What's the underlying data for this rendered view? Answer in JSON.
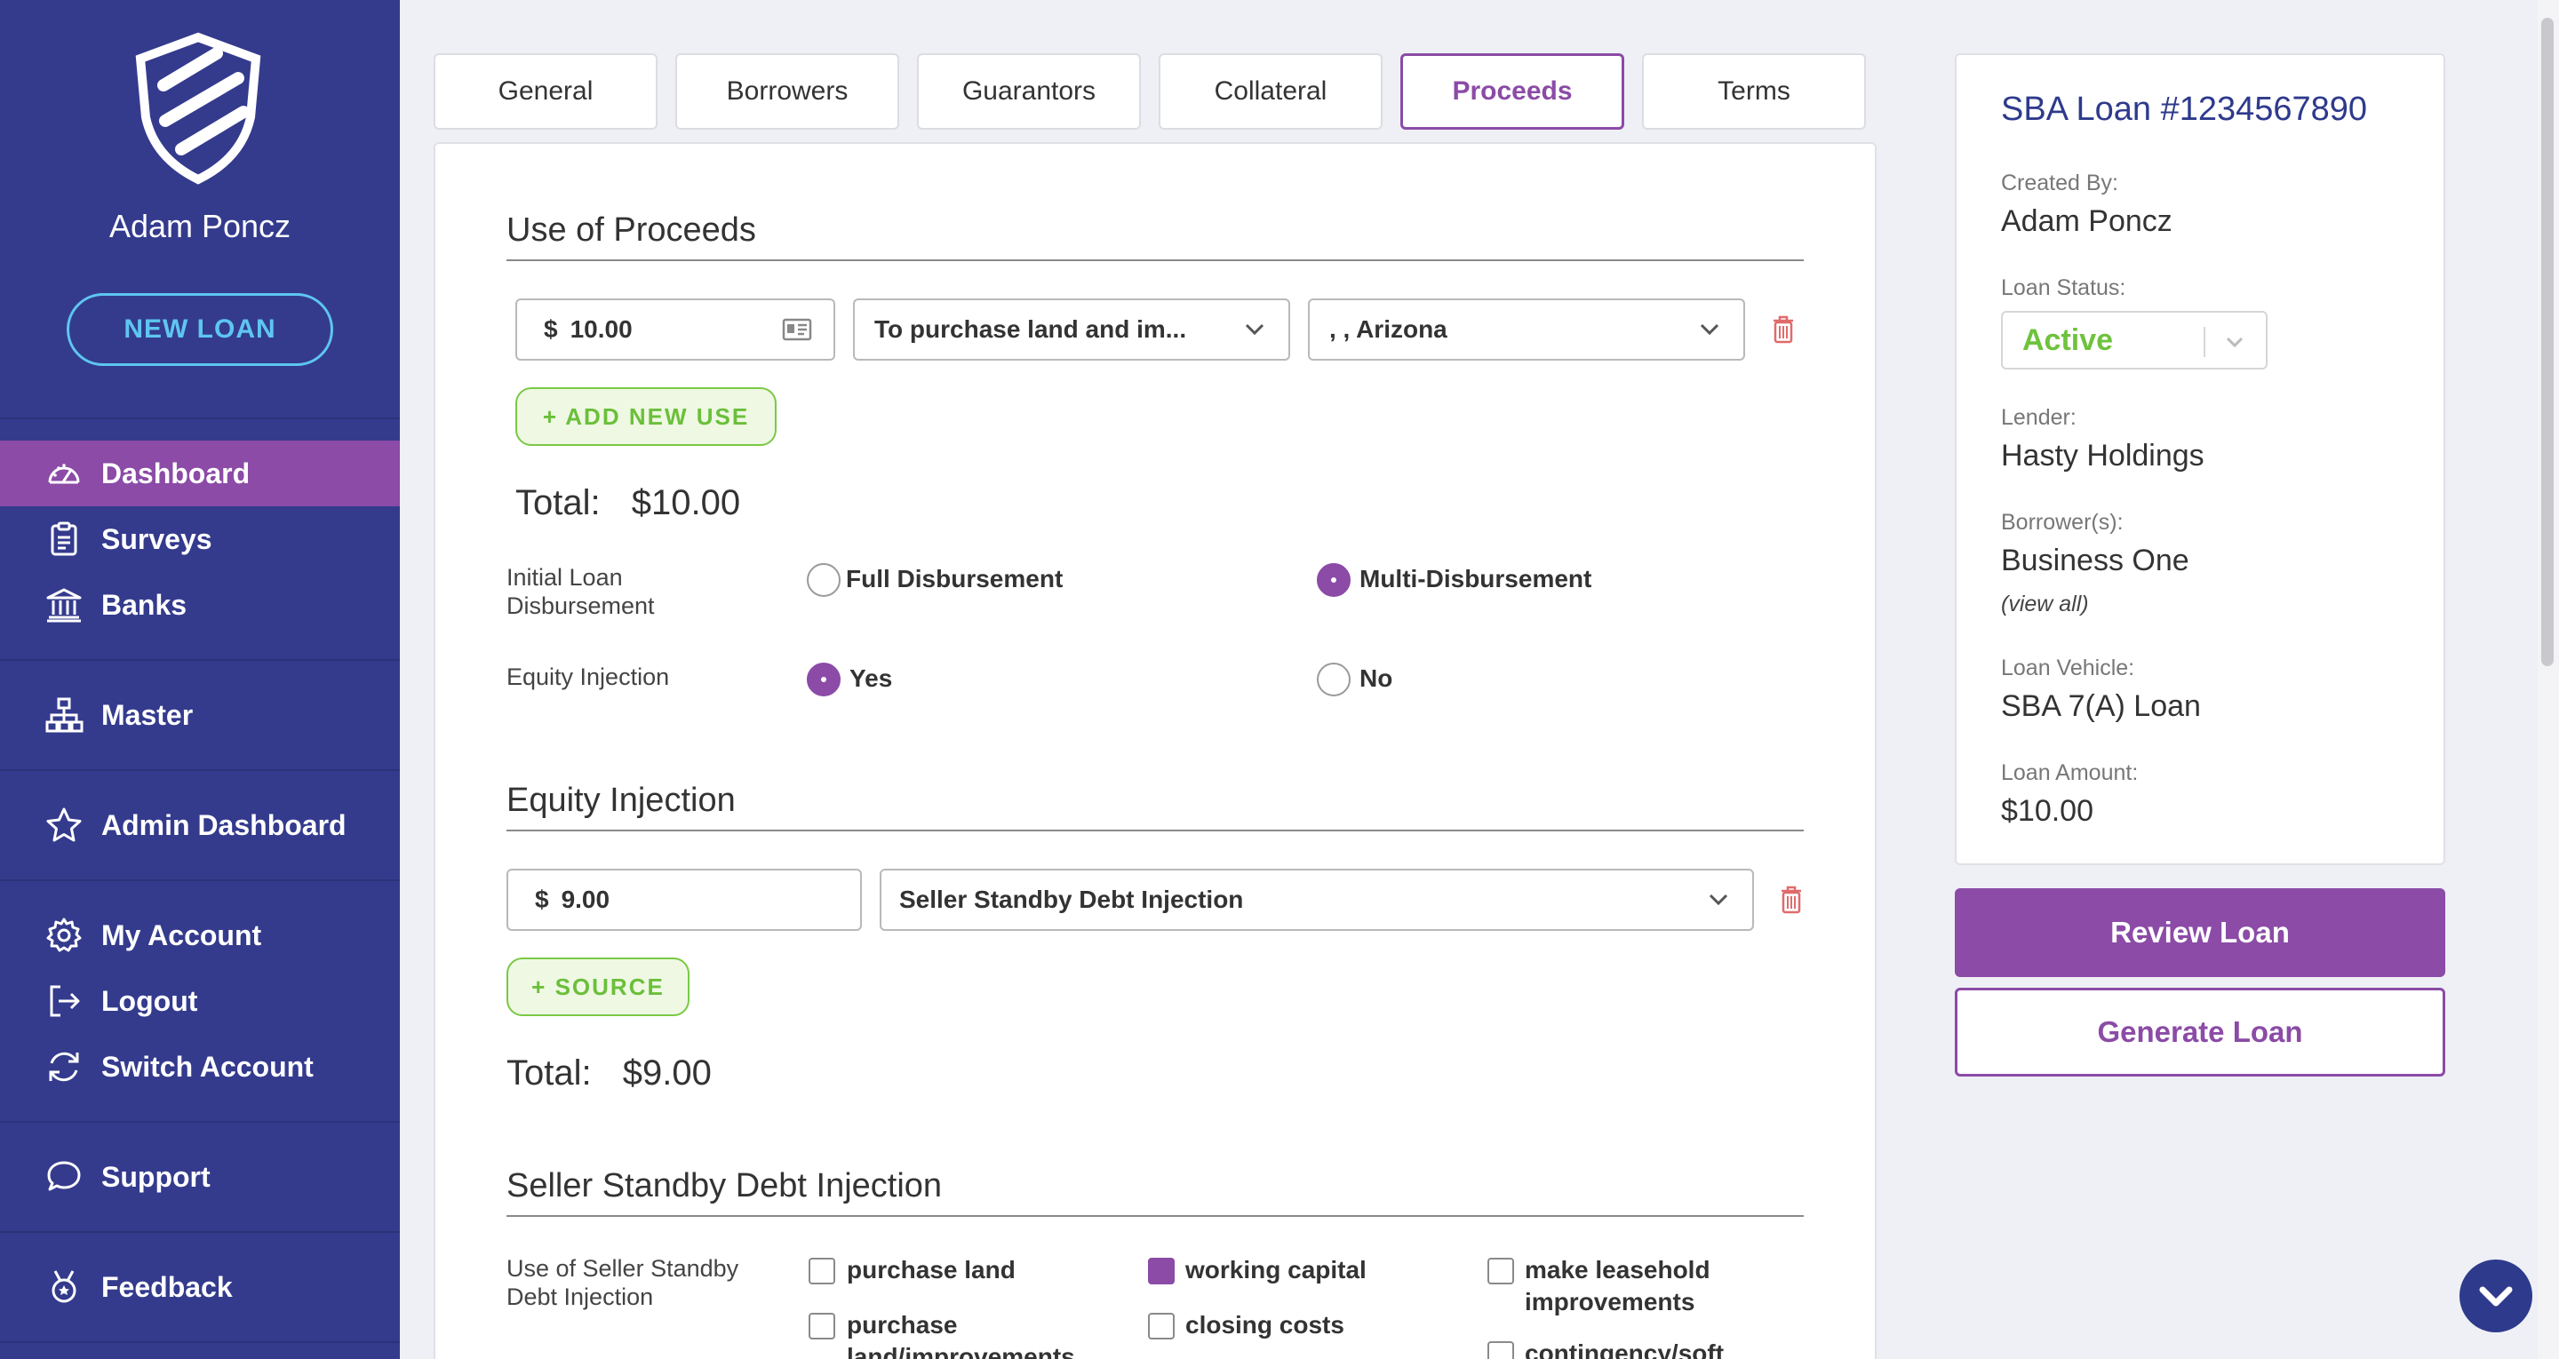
{
  "sidebar": {
    "user_name": "Adam Poncz",
    "new_loan_label": "NEW LOAN",
    "items": [
      {
        "label": "Dashboard",
        "icon": "speedometer-icon",
        "active": true
      },
      {
        "label": "Surveys",
        "icon": "clipboard-icon"
      },
      {
        "label": "Banks",
        "icon": "bank-icon"
      },
      {
        "label": "Master",
        "icon": "sitemap-icon"
      },
      {
        "label": "Admin Dashboard",
        "icon": "star-icon"
      },
      {
        "label": "My Account",
        "icon": "gear-icon"
      },
      {
        "label": "Logout",
        "icon": "logout-icon"
      },
      {
        "label": "Switch Account",
        "icon": "refresh-icon"
      },
      {
        "label": "Support",
        "icon": "chat-icon"
      },
      {
        "label": "Feedback",
        "icon": "award-icon"
      }
    ]
  },
  "tabs": [
    "General",
    "Borrowers",
    "Guarantors",
    "Collateral",
    "Proceeds",
    "Terms"
  ],
  "active_tab": "Proceeds",
  "use_of_proceeds": {
    "title": "Use of Proceeds",
    "amount_currency": "$",
    "amount": "10.00",
    "use_type": "To purchase land and im...",
    "location": ", , Arizona",
    "add_label": "+ ADD NEW USE",
    "total_label": "Total:",
    "total_value": "$10.00"
  },
  "disbursement": {
    "label": "Initial Loan Disbursement",
    "options": [
      "Full Disbursement",
      "Multi-Disbursement"
    ],
    "selected": "Multi-Disbursement"
  },
  "equity_question": {
    "label": "Equity Injection",
    "options": [
      "Yes",
      "No"
    ],
    "selected": "Yes"
  },
  "equity_injection": {
    "title": "Equity Injection",
    "amount_currency": "$",
    "amount": "9.00",
    "source_type": "Seller Standby Debt Injection",
    "add_label": "+ SOURCE",
    "total_label": "Total:",
    "total_value": "$9.00"
  },
  "seller_standby": {
    "title": "Seller Standby Debt Injection",
    "label": "Use of Seller Standby Debt Injection",
    "options": [
      {
        "label": "purchase land",
        "checked": false
      },
      {
        "label": "working capital",
        "checked": true
      },
      {
        "label": "make leasehold improvements",
        "checked": false
      },
      {
        "label": "purchase land/improvements",
        "checked": false
      },
      {
        "label": "closing costs",
        "checked": false
      },
      {
        "label": "contingency/soft",
        "checked": false
      }
    ]
  },
  "loan_info": {
    "title": "SBA Loan #1234567890",
    "created_by_label": "Created By:",
    "created_by": "Adam Poncz",
    "status_label": "Loan Status:",
    "status": "Active",
    "lender_label": "Lender:",
    "lender": "Hasty Holdings",
    "borrowers_label": "Borrower(s):",
    "borrowers": "Business One",
    "view_all": "(view all)",
    "vehicle_label": "Loan Vehicle:",
    "vehicle": "SBA 7(A) Loan",
    "amount_label": "Loan Amount:",
    "amount": "$10.00"
  },
  "actions": {
    "review": "Review Loan",
    "generate": "Generate Loan"
  },
  "colors": {
    "sidebar": "#343b8d",
    "accent": "#8b4ba6",
    "green": "#6fc23d",
    "link_blue": "#2e3a8c"
  }
}
